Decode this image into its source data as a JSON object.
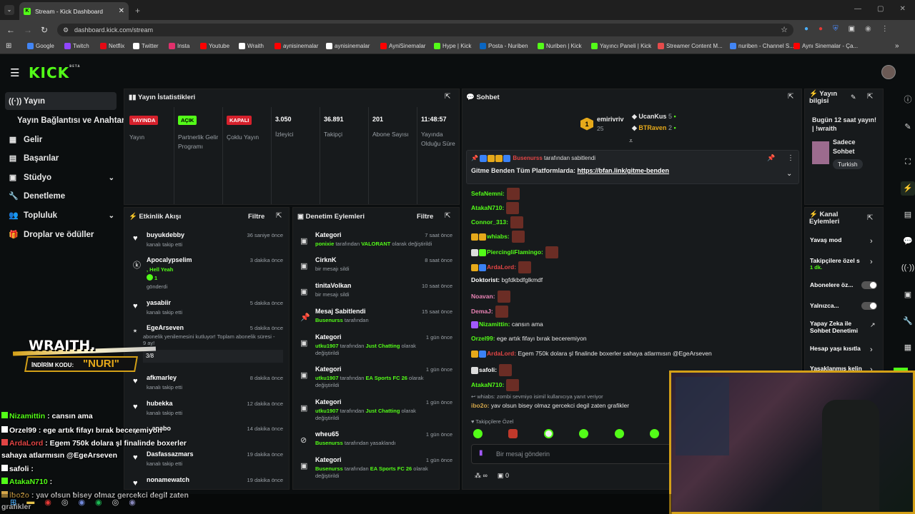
{
  "browser": {
    "tab_title": "Stream - Kick Dashboard",
    "url": "dashboard.kick.com/stream",
    "bookmarks": [
      {
        "label": "Google",
        "color": "#4285f4"
      },
      {
        "label": "Twitch",
        "color": "#9146ff"
      },
      {
        "label": "Netflix",
        "color": "#e50914"
      },
      {
        "label": "Twitter",
        "color": "#ffffff"
      },
      {
        "label": "Insta",
        "color": "#e1306c"
      },
      {
        "label": "Youtube",
        "color": "#ff0000"
      },
      {
        "label": "Wraith",
        "color": "#ffffff"
      },
      {
        "label": "aynisinemalar",
        "color": "#ff0000"
      },
      {
        "label": "aynisinemalar",
        "color": "#ffffff"
      },
      {
        "label": "AyniSinemalar",
        "color": "#ff0000"
      },
      {
        "label": "Hype | Kick",
        "color": "#53fc18"
      },
      {
        "label": "Posta - Nuriben",
        "color": "#0a66c2"
      },
      {
        "label": "Nuriben | Kick",
        "color": "#53fc18"
      },
      {
        "label": "Yayıncı Paneli | Kick",
        "color": "#53fc18"
      },
      {
        "label": "Streamer Content M...",
        "color": "#e54b4b"
      },
      {
        "label": "nuriben - Channel S...",
        "color": "#4285f4"
      },
      {
        "label": "Aynı Sinemalar - Ça...",
        "color": "#ff0000"
      }
    ]
  },
  "brand": {
    "logo": "KICK",
    "beta": "BETA",
    "accent": "#53fc18"
  },
  "sidebar": {
    "items": [
      {
        "label": "Yayın",
        "icon": "broadcast-icon"
      },
      {
        "label": "Yayın Bağlantısı ve Anahtarı"
      },
      {
        "label": "Gelir",
        "icon": "revenue-icon"
      },
      {
        "label": "Başarılar",
        "icon": "achievements-icon"
      },
      {
        "label": "Stüdyo",
        "icon": "studio-icon"
      },
      {
        "label": "Denetleme",
        "icon": "wrench-icon"
      },
      {
        "label": "Topluluk",
        "icon": "community-icon"
      },
      {
        "label": "Droplar ve ödüller",
        "icon": "gift-icon"
      }
    ]
  },
  "stats": {
    "title": "Yayın İstatistikleri",
    "cells": [
      {
        "badge": "YAYINDA",
        "label": "Yayın",
        "badge_color": "#d6212c"
      },
      {
        "badge": "AÇIK",
        "label": "Partnerlik Gelir Programı",
        "badge_color": "#53fc18"
      },
      {
        "badge": "KAPALI",
        "label": "Çoklu Yayın",
        "badge_color": "#d6212c"
      },
      {
        "value": "3.050",
        "label": "İzleyici"
      },
      {
        "value": "36.891",
        "label": "Takipçi"
      },
      {
        "value": "201",
        "label": "Abone Sayısı"
      },
      {
        "value": "11:48:57",
        "label": "Yayında Olduğu Süre"
      }
    ]
  },
  "events": {
    "title": "Etkinlik Akışı",
    "filter": "Filtre",
    "items": [
      {
        "name": "buyukdebby",
        "sub": "kanalı takip etti",
        "time": "36 saniye önce"
      },
      {
        "name": "Apocalypselim",
        "sub1": ", Hell Yeah",
        "sub2": "1",
        "sub3": "gönderdi",
        "time": "3 dakika önce"
      },
      {
        "name": "yasabiir",
        "sub": "kanalı takip etti",
        "time": "5 dakika önce"
      },
      {
        "name": "EgeArseven",
        "sub": "abonelik yenilemesini kutluyor! Toplam abonelik süresi - 9 ay!",
        "page": "3/8",
        "time": "5 dakika önce"
      },
      {
        "name": "afkmarley",
        "sub": "kanalı takip etti",
        "time": "8 dakika önce"
      },
      {
        "name": "hubekka",
        "sub": "kanalı takip etti",
        "time": "12 dakika önce"
      },
      {
        "name": "...anabo",
        "sub": "",
        "time": "14 dakika önce"
      },
      {
        "name": "Dasfassazmars",
        "sub": "kanalı takip etti",
        "time": "19 dakika önce"
      },
      {
        "name": "nonamewatch",
        "sub": "",
        "time": "19 dakika önce"
      }
    ]
  },
  "moderation": {
    "title": "Denetim Eylemleri",
    "filter": "Filtre",
    "items": [
      {
        "title": "Kategori",
        "l1a": "ponixie",
        "l1b": " tarafından ",
        "l1c": "VALORANT",
        "l1d": " olarak değiştirildi",
        "time": "7 saat önce"
      },
      {
        "title": "CirknK",
        "l1a": "",
        "l1b": "bir mesajı sildi",
        "l1c": "",
        "l1d": "",
        "time": "8 saat önce"
      },
      {
        "title": "tinitaVolkan",
        "l1a": "",
        "l1b": "bir mesajı sildi",
        "l1c": "",
        "l1d": "",
        "time": "10 saat önce"
      },
      {
        "title": "Mesaj Sabitlendi",
        "l1a": "Busenurss",
        "l1b": " tarafından",
        "l1c": "",
        "l1d": "",
        "time": "15 saat önce"
      },
      {
        "title": "Kategori",
        "l1a": "utku1907",
        "l1b": " tarafından ",
        "l1c": "Just Chatting",
        "l1d": " olarak değiştirildi",
        "time": "1 gün önce"
      },
      {
        "title": "Kategori",
        "l1a": "utku1907",
        "l1b": " tarafından ",
        "l1c": "EA Sports FC 26",
        "l1d": " olarak değiştirildi",
        "time": "1 gün önce"
      },
      {
        "title": "Kategori",
        "l1a": "utku1907",
        "l1b": " tarafından ",
        "l1c": "Just Chatting",
        "l1d": " olarak değiştirildi",
        "time": "1 gün önce"
      },
      {
        "title": "wheu65",
        "l1a": "Busenurss",
        "l1b": " tarafından yasaklandı",
        "l1c": "",
        "l1d": "",
        "time": "1 gün önce"
      },
      {
        "title": "Kategori",
        "l1a": "Busenurss",
        "l1b": " tarafından ",
        "l1c": "EA Sports FC 26",
        "l1d": " olarak değiştirildi",
        "time": "1 gün önce"
      }
    ]
  },
  "chat": {
    "title": "Sohbet",
    "leaders": [
      {
        "name": "emirivriv",
        "count": "25",
        "rank": "1"
      },
      {
        "name": "UcanKus",
        "count": "5"
      },
      {
        "name": "BTRaven",
        "count": "2"
      }
    ],
    "pinned_by": "Busenurss",
    "pinned_suffix": " tarafından sabitlendi",
    "pinned_text": "Gitme Benden Tüm Platformlarda: ",
    "pinned_link": "https://bfan.link/gitme-benden",
    "messages": [
      {
        "user": "SefaNemni:",
        "color": "#53fc18",
        "text": "",
        "emote": true
      },
      {
        "user": "AtakaN710:",
        "color": "#53fc18",
        "text": "",
        "emote": true
      },
      {
        "user": "Connor_313:",
        "color": "#53fc18",
        "text": "",
        "emote": true
      },
      {
        "user": "whiabs:",
        "color": "#53fc18",
        "text": "",
        "emote": true
      },
      {
        "user": "PiercingliFlamingo:",
        "color": "#53fc18",
        "text": "",
        "emote": true
      },
      {
        "user": "ArdaLord:",
        "color": "#e24545",
        "text": "",
        "emote": true
      },
      {
        "user": "Doktorist:",
        "color": "#ffffff",
        "text": " bgfdkbdfglkmdf",
        "emote": false
      },
      {
        "user": "Noavan:",
        "color": "#e983b5",
        "text": "",
        "emote": true
      },
      {
        "user": "DemaJ:",
        "color": "#e983b5",
        "text": "",
        "emote": true
      },
      {
        "user": "Nizamittin:",
        "color": "#53fc18",
        "text": " cansın ama",
        "emote": false
      },
      {
        "user": "Orzel99:",
        "color": "#53fc18",
        "text": " ege artık fifayı bırak beceremiyon",
        "emote": false
      },
      {
        "user": "ArdaLord:",
        "color": "#e24545",
        "text": " Egem 750k dolara şl finalinde boxerler sahaya atlarmısın @EgeArseven",
        "emote": false
      },
      {
        "user": "safoli:",
        "color": "#ffffff",
        "text": "",
        "emote": true
      },
      {
        "user": "AtakaN710:",
        "color": "#53fc18",
        "text": "",
        "emote": true
      }
    ],
    "reply_note": "whiabs: zombi sevmiyo isimil kullanıcıya yanıt veriyor",
    "last_user": "ibo2o:",
    "last_text": " yav olsun bisey olmaz gercekci degil zaten grafikler",
    "followers_only": "Takipçilere Özel",
    "input_placeholder": "Bir mesaj gönderin",
    "footer_count": "0"
  },
  "stream_info": {
    "title": "Yayın bilgisi",
    "stream_title": "Bugün 12 saat yayın! | !wraith",
    "category": "Sadece Sohbet",
    "language": "Turkish"
  },
  "channel_actions": {
    "title": "Kanal Eylemleri",
    "items": [
      {
        "label": "Yavaş mod",
        "sub": ""
      },
      {
        "label": "Takipçilere özel s",
        "sub": "1 dk."
      },
      {
        "label": "Abonelere öz...",
        "sub": ""
      },
      {
        "label": "Yalnızca...",
        "sub": ""
      },
      {
        "label": "Yapay Zeka ile Sohbet Denetimi",
        "sub": ""
      },
      {
        "label": "Hesap yaşı kısıtla",
        "sub": ""
      },
      {
        "label": "Yasaklanmış kelin",
        "sub": ""
      }
    ]
  },
  "overlay": {
    "sponsor": "WRAITH.",
    "code_label": "İNDİRİM KODU:",
    "code": "\"NURI\"",
    "chat": [
      {
        "user": "Nizamittin",
        "text": " : cansın ama",
        "color": "#53fc18"
      },
      {
        "user": "Orzel99",
        "text": " : ege artık fifayı bırak beceremiyon",
        "color": "#ffffff"
      },
      {
        "user": "ArdaLord",
        "text": " : Egem 750k dolara şl finalinde boxerler",
        "color": "#e24545"
      },
      {
        "user": "",
        "text": "sahaya atlarmısın @EgeArseven",
        "color": "#ffffff"
      },
      {
        "user": "safoli",
        "text": " :",
        "color": "#ffffff"
      },
      {
        "user": "AtakaN710",
        "text": " :",
        "color": "#53fc18"
      },
      {
        "user": "ibo2o",
        "text": " : yav olsun bisey olmaz gercekci degil zaten",
        "color": "#d4a64a"
      },
      {
        "user": "",
        "text": "grafikler",
        "color": "#ffffff"
      }
    ]
  }
}
